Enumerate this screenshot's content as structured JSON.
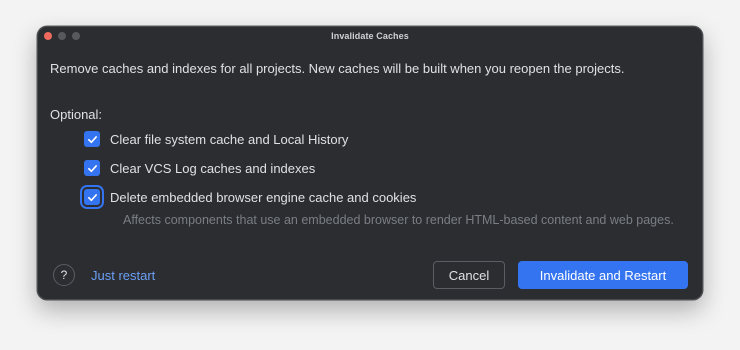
{
  "window": {
    "title": "Invalidate Caches"
  },
  "dialog": {
    "message": "Remove caches and indexes for all projects. New caches will be built when you reopen the projects.",
    "optional_label": "Optional:",
    "options": [
      {
        "label": "Clear file system cache and Local History",
        "checked": true
      },
      {
        "label": "Clear VCS Log caches and indexes",
        "checked": true
      },
      {
        "label": "Delete embedded browser engine cache and cookies",
        "checked": true
      }
    ],
    "hint": "Affects components that use an embedded browser to render HTML-based content and web pages.",
    "help_glyph": "?",
    "just_restart_label": "Just restart",
    "cancel_label": "Cancel",
    "primary_label": "Invalidate and Restart"
  },
  "colors": {
    "background": "#2b2d30",
    "accent": "#3574f0",
    "link": "#6c9ff5",
    "text": "#dfe1e5",
    "muted": "#7a7e85"
  }
}
